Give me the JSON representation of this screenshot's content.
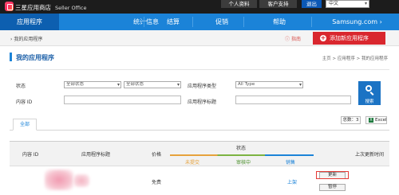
{
  "topbar": {
    "brand": "三星应用商店",
    "brand_sub": "Seller Office",
    "account": "个人资料",
    "support": "客户支持",
    "logout": "退出",
    "language": "中文"
  },
  "nav": {
    "items": [
      {
        "label": "应用程序",
        "active": true
      },
      {
        "label": "统计信息"
      },
      {
        "label": "结算"
      },
      {
        "label": "促销"
      },
      {
        "label": "帮助"
      },
      {
        "label": "Samsung.com"
      }
    ]
  },
  "breadcrumb": {
    "current": "我的应用程序",
    "guide": "指南",
    "add_button": "添加新应用程序"
  },
  "page": {
    "title": "我的应用程序",
    "path": "主页 > 应用程序 > 我的应用程序"
  },
  "filters": {
    "status_label": "状态",
    "status_value_1": "全部状态",
    "status_value_2": "全部状态",
    "app_type_label": "应用程序类型",
    "app_type_value": "All Type",
    "content_id_label": "内容 ID",
    "app_title_label": "应用程序标题",
    "search_button": "搜索"
  },
  "tabs": {
    "all": "全部",
    "total": "总数：3",
    "excel": "Excel"
  },
  "table": {
    "headers": {
      "content_id": "内容 ID",
      "app_title": "应用程序标题",
      "price": "价格",
      "status": "状态",
      "status_not_submitted": "未提交",
      "status_reviewing": "审核中",
      "status_sale": "销售",
      "last_updated": "上次更新时间"
    },
    "rows": [
      {
        "price": "免费",
        "sale_status": "上架",
        "update_button": "更新",
        "suspend_button": "暂停"
      }
    ]
  },
  "colors": {
    "nav": "#1b83d8",
    "nav_active": "#0d5fb0",
    "add_button": "#d9272e",
    "highlight": "#e53935"
  }
}
